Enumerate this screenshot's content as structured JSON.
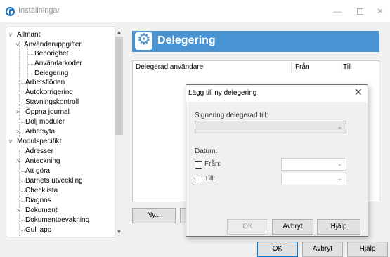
{
  "window": {
    "title": "Inställningar",
    "controls": {
      "minimize": "—",
      "close": "✕"
    }
  },
  "tree": {
    "items": [
      {
        "label": "Allmänt",
        "expander": "v"
      },
      {
        "label": "Användaruppgifter",
        "expander": "v"
      },
      {
        "label": "Behörighet"
      },
      {
        "label": "Användarkoder"
      },
      {
        "label": "Delegering"
      },
      {
        "label": "Arbetsflöden"
      },
      {
        "label": "Autokorrigering"
      },
      {
        "label": "Stavningskontroll"
      },
      {
        "label": "Öppna journal",
        "expander": ">"
      },
      {
        "label": "Dölj moduler"
      },
      {
        "label": "Arbetsyta",
        "expander": ">"
      },
      {
        "label": "Modulspecifikt",
        "expander": "v"
      },
      {
        "label": "Adresser"
      },
      {
        "label": "Anteckning",
        "expander": ">"
      },
      {
        "label": "Att göra"
      },
      {
        "label": "Barnets utveckling"
      },
      {
        "label": "Checklista"
      },
      {
        "label": "Diagnos"
      },
      {
        "label": "Dokument",
        "expander": ">"
      },
      {
        "label": "Dokumentbevakning"
      },
      {
        "label": "Gul lapp"
      }
    ],
    "scroll": {
      "up": "▲",
      "down": "▼"
    }
  },
  "panel": {
    "title": "Delegering",
    "columns": [
      "Delegerad användare",
      "Från",
      "Till"
    ],
    "new_button": "Ny..."
  },
  "footer": {
    "ok": "OK",
    "cancel": "Avbryt",
    "help": "Hjälp"
  },
  "dialog": {
    "title": "Lägg till ny delegering",
    "close": "✕",
    "sign_label": "Signering delegerad till:",
    "date_label": "Datum:",
    "from_label": "Från:",
    "to_label": "Till:",
    "chevron": "⌄",
    "ok": "OK",
    "cancel": "Avbryt",
    "help": "Hjälp"
  }
}
